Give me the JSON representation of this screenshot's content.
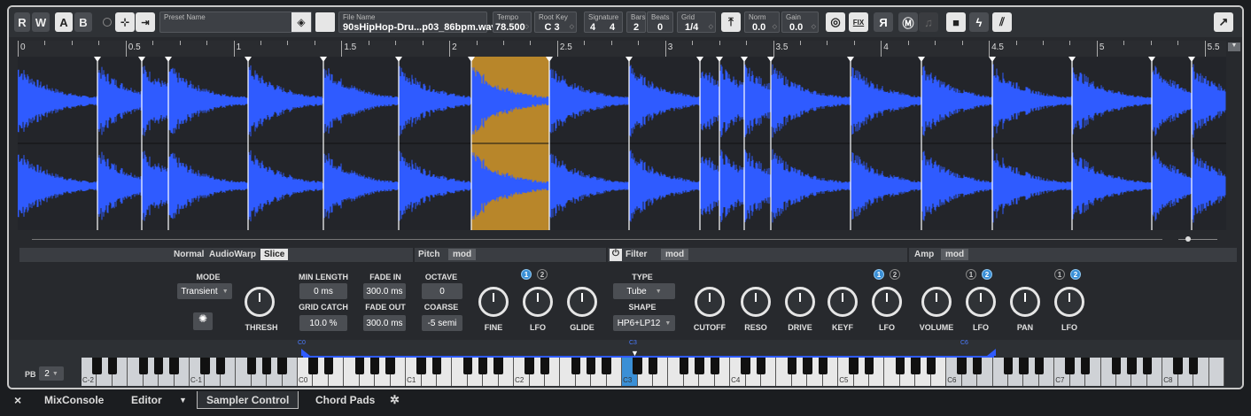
{
  "toolbar": {
    "r": "R",
    "w": "W",
    "a": "A",
    "b": "B",
    "preset_label": "Preset Name",
    "file_label": "File Name",
    "file_value": "90sHipHop-Dru...p03_86bpm.wav",
    "tempo_label": "Tempo",
    "tempo_value": "78.500",
    "rootkey_label": "Root Key",
    "rootkey_value": "C 3",
    "signature_label": "Signature",
    "sig_num": "4",
    "sig_den": "4",
    "bars_label": "Bars",
    "bars_value": "2",
    "beats_label": "Beats",
    "beats_value": "0",
    "grid_label": "Grid",
    "grid_value": "1/4",
    "norm_label": "Norm",
    "norm_value": "0.0",
    "gain_label": "Gain",
    "gain_value": "0.0",
    "fix_label": "FIX",
    "r_label": "R",
    "m_label": "M"
  },
  "ruler": {
    "labels": [
      "0",
      "0.5",
      "1",
      "1.5",
      "2",
      "2.5",
      "3",
      "3.5",
      "4",
      "4.5",
      "5",
      "5.5"
    ]
  },
  "warp": {
    "normal": "Normal",
    "audiowarp": "AudioWarp",
    "slice": "Slice",
    "mode_label": "MODE",
    "mode_value": "Transient",
    "min_length_label": "MIN LENGTH",
    "min_length_value": "0 ms",
    "fade_in_label": "FADE IN",
    "fade_in_value": "300.0 ms",
    "grid_catch_label": "GRID CATCH",
    "grid_catch_value": "10.0 %",
    "fade_out_label": "FADE OUT",
    "fade_out_value": "300.0 ms",
    "thresh_label": "THRESH"
  },
  "pitch": {
    "title": "Pitch",
    "mod": "mod",
    "octave_label": "OCTAVE",
    "octave_value": "0",
    "coarse_label": "COARSE",
    "coarse_value": "-5 semi",
    "fine": "FINE",
    "lfo": "LFO",
    "glide": "GLIDE",
    "n1": "1",
    "n2": "2"
  },
  "filter": {
    "title": "Filter",
    "mod": "mod",
    "type_label": "TYPE",
    "type_value": "Tube",
    "shape_label": "SHAPE",
    "shape_value": "HP6+LP12",
    "cutoff": "CUTOFF",
    "reso": "RESO",
    "drive": "DRIVE",
    "keyf": "KEYF",
    "lfo": "LFO",
    "n1": "1",
    "n2": "2"
  },
  "amp": {
    "title": "Amp",
    "mod": "mod",
    "volume": "VOLUME",
    "lfo1": "LFO",
    "pan": "PAN",
    "lfo2": "LFO",
    "n1": "1",
    "n2": "2"
  },
  "keyboard": {
    "pb_label": "PB",
    "pb_value": "2",
    "labels": [
      "C-2",
      "C-1",
      "C0",
      "C1",
      "C2",
      "C3",
      "C4",
      "C5",
      "C6",
      "C7",
      "C8"
    ],
    "marker_low": "C0",
    "marker_root": "C3",
    "marker_high": "C6"
  },
  "tabs": {
    "close": "×",
    "mixconsole": "MixConsole",
    "editor": "Editor",
    "sampler": "Sampler Control",
    "chordpads": "Chord Pads"
  },
  "colors": {
    "wave": "#2f5bff",
    "slice_selected": "#b8862a",
    "accent": "#3a8fd6"
  }
}
